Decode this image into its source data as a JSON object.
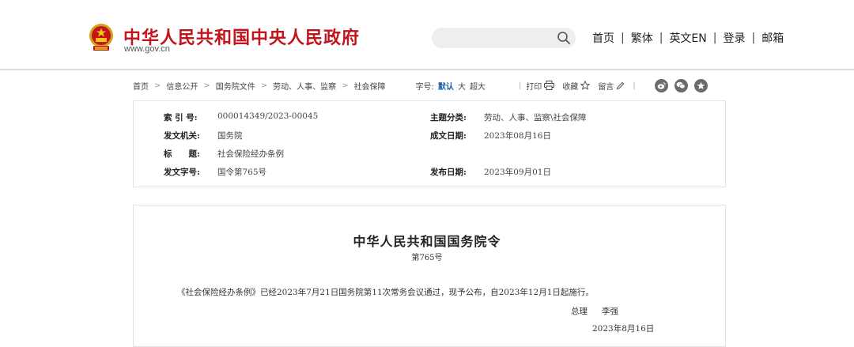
{
  "header": {
    "site_title": "中华人民共和国中央人民政府",
    "site_domain": "www.gov.cn",
    "search": {
      "value": "",
      "placeholder": ""
    },
    "nav": [
      {
        "label": "首页"
      },
      {
        "label": "繁体"
      },
      {
        "label": "英文EN"
      },
      {
        "label": "登录"
      },
      {
        "label": "邮箱"
      }
    ],
    "nav_separator": "|"
  },
  "breadcrumb": {
    "items": [
      "首页",
      "信息公开",
      "国务院文件",
      "劳动、人事、监察",
      "社会保障"
    ],
    "separator": ">"
  },
  "font_size": {
    "label": "字号:",
    "options": [
      {
        "label": "默认",
        "active": true
      },
      {
        "label": "大",
        "active": false
      },
      {
        "label": "超大",
        "active": false
      }
    ]
  },
  "tools": {
    "divider": "|",
    "print_label": "打印",
    "favorite_label": "收藏",
    "comment_label": "留言"
  },
  "share": [
    "weibo-icon",
    "wechat-icon",
    "qzone-icon"
  ],
  "metadata": {
    "index_label": "索 引 号:",
    "index_value": "000014349/2023-00045",
    "topic_label": "主题分类:",
    "topic_value": "劳动、人事、监察\\社会保障",
    "issuer_label": "发文机关:",
    "issuer_value": "国务院",
    "written_label": "成文日期:",
    "written_value": "2023年08月16日",
    "title_label": "标　　题:",
    "title_value": "社会保险经办条例",
    "docnum_label": "发文字号:",
    "docnum_value": "国令第765号",
    "published_label": "发布日期:",
    "published_value": "2023年09月01日"
  },
  "document": {
    "title": "中华人民共和国国务院令",
    "number": "第765号",
    "body": "《社会保险经办条例》已经2023年7月21日国务院第11次常务会议通过，现予公布，自2023年12月1日起施行。",
    "signature_title": "总理",
    "signature_name": "李强",
    "date": "2023年8月16日"
  },
  "colors": {
    "brand_red": "#c1141b",
    "accent_blue": "#1a5da8",
    "share_gray": "#6b6b6b"
  }
}
